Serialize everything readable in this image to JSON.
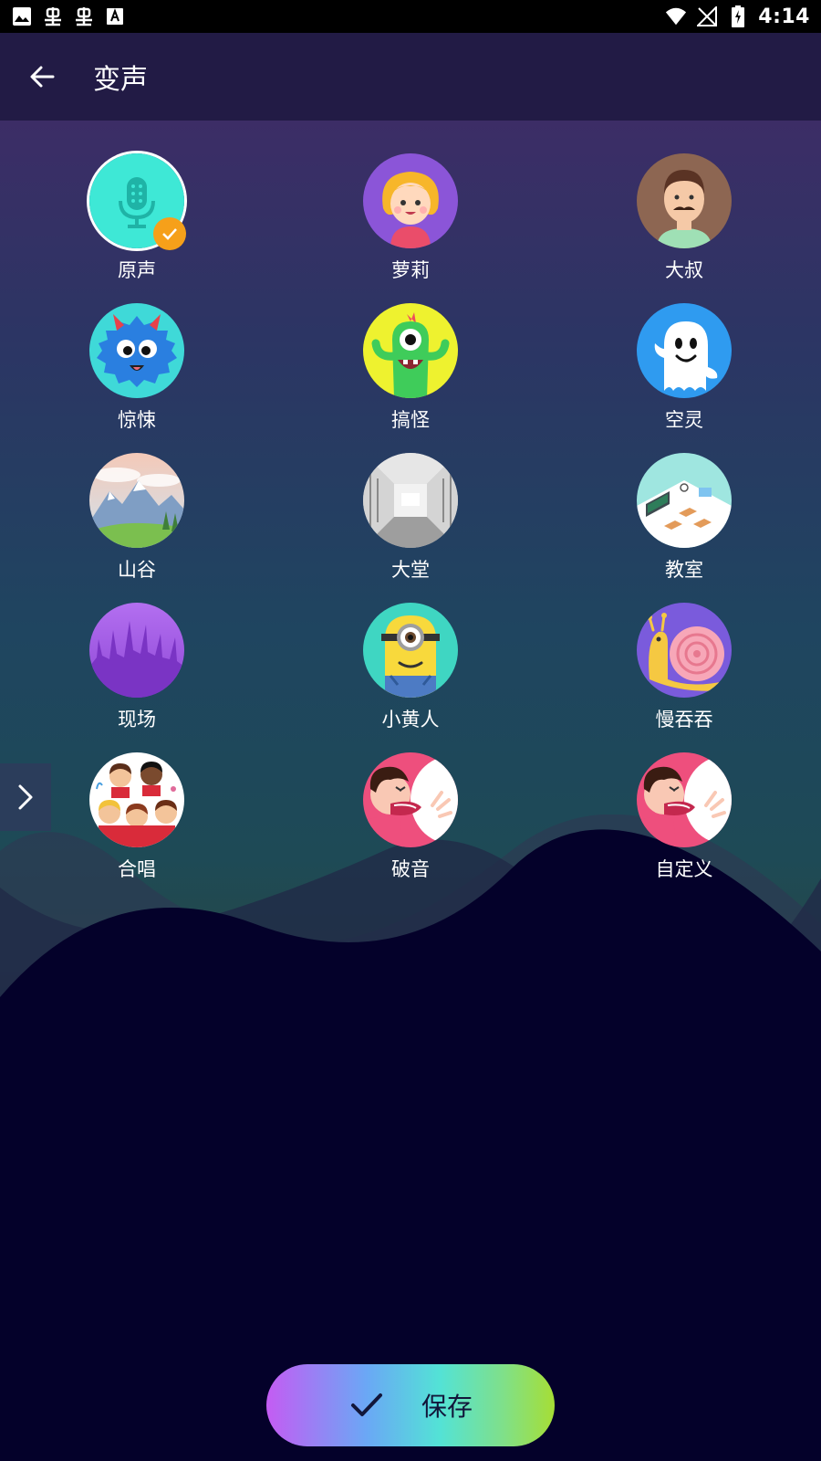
{
  "status_bar": {
    "left_icons": [
      "image-icon",
      "bug-icon",
      "bug-icon",
      "a-badge-icon"
    ],
    "right_icons": [
      "wifi-icon",
      "no-signal-icon",
      "battery-charging-icon"
    ],
    "time": "4:14"
  },
  "app_bar": {
    "back_icon": "back-arrow-icon",
    "title": "变声"
  },
  "voices": [
    {
      "label": "原声",
      "icon": "microphone-icon",
      "selected": true
    },
    {
      "label": "萝莉",
      "icon": "girl-icon",
      "selected": false
    },
    {
      "label": "大叔",
      "icon": "mustache-man-icon",
      "selected": false
    },
    {
      "label": "惊悚",
      "icon": "blue-monster-icon",
      "selected": false
    },
    {
      "label": "搞怪",
      "icon": "green-alien-icon",
      "selected": false
    },
    {
      "label": "空灵",
      "icon": "ghost-icon",
      "selected": false
    },
    {
      "label": "山谷",
      "icon": "mountain-valley-icon",
      "selected": false
    },
    {
      "label": "大堂",
      "icon": "hall-icon",
      "selected": false
    },
    {
      "label": "教室",
      "icon": "classroom-icon",
      "selected": false
    },
    {
      "label": "现场",
      "icon": "concert-crowd-icon",
      "selected": false
    },
    {
      "label": "小黄人",
      "icon": "minion-icon",
      "selected": false
    },
    {
      "label": "慢吞吞",
      "icon": "snail-icon",
      "selected": false
    },
    {
      "label": "合唱",
      "icon": "choir-icon",
      "selected": false
    },
    {
      "label": "破音",
      "icon": "shouting-man-icon",
      "selected": false
    },
    {
      "label": "自定义",
      "icon": "shouting-man-icon",
      "selected": false
    }
  ],
  "side_handle_icon": "chevron-right-icon",
  "save_button": {
    "label": "保存",
    "icon": "check-icon"
  },
  "colors": {
    "app_bar": "#221b45",
    "selected_badge": "#f6a01a",
    "background_bottom": "#04012a"
  }
}
